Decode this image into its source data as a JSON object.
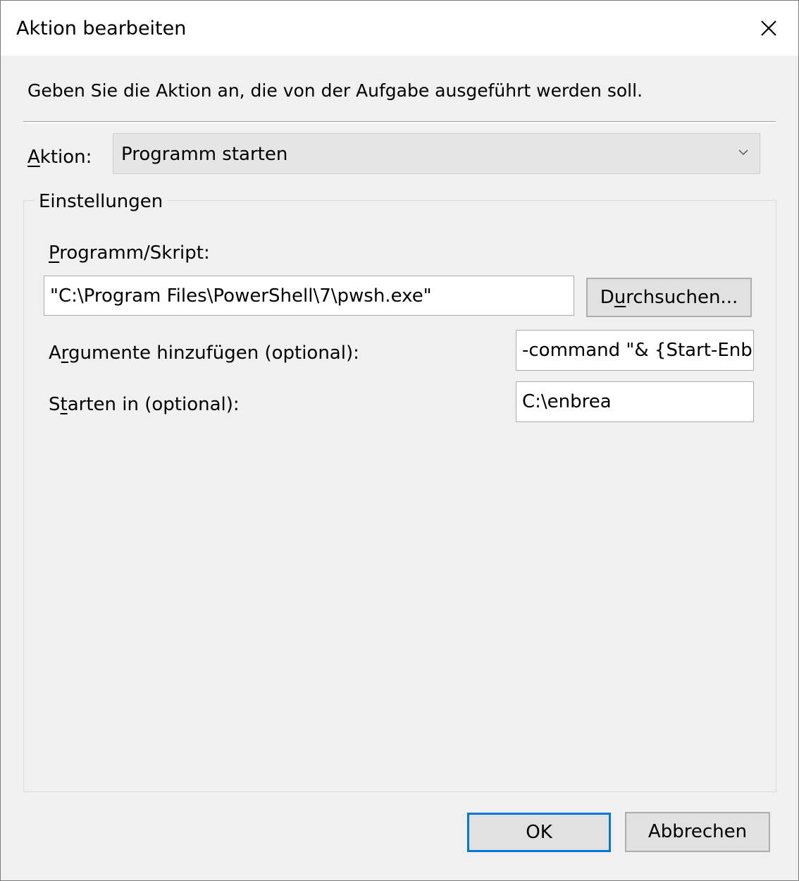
{
  "window": {
    "title": "Aktion bearbeiten",
    "close_icon": "close-icon"
  },
  "instruction": "Geben Sie die Aktion an, die von der Aufgabe ausgeführt werden soll.",
  "action": {
    "label_accesskey": "A",
    "label_rest": "ktion:",
    "selected": "Programm starten"
  },
  "settings": {
    "legend": "Einstellungen",
    "program": {
      "label_accesskey": "P",
      "label_rest": "rogramm/Skript:",
      "value": "\"C:\\Program Files\\PowerShell\\7\\pwsh.exe\"",
      "browse_pre": "D",
      "browse_accesskey": "u",
      "browse_post": "rchsuchen..."
    },
    "arguments": {
      "label_pre": "A",
      "label_accesskey": "r",
      "label_post": "gumente hinzufügen (optional):",
      "value": "-command \"& {Start-Enbrea"
    },
    "start_in": {
      "label_pre": "S",
      "label_accesskey": "t",
      "label_post": "arten in (optional):",
      "value": "C:\\enbrea"
    }
  },
  "buttons": {
    "ok": "OK",
    "cancel": "Abbrechen"
  },
  "colors": {
    "dialog_bg": "#f0f0f0",
    "titlebar_bg": "#ffffff",
    "default_button_border": "#0078d7",
    "button_bg": "#e1e1e1"
  }
}
